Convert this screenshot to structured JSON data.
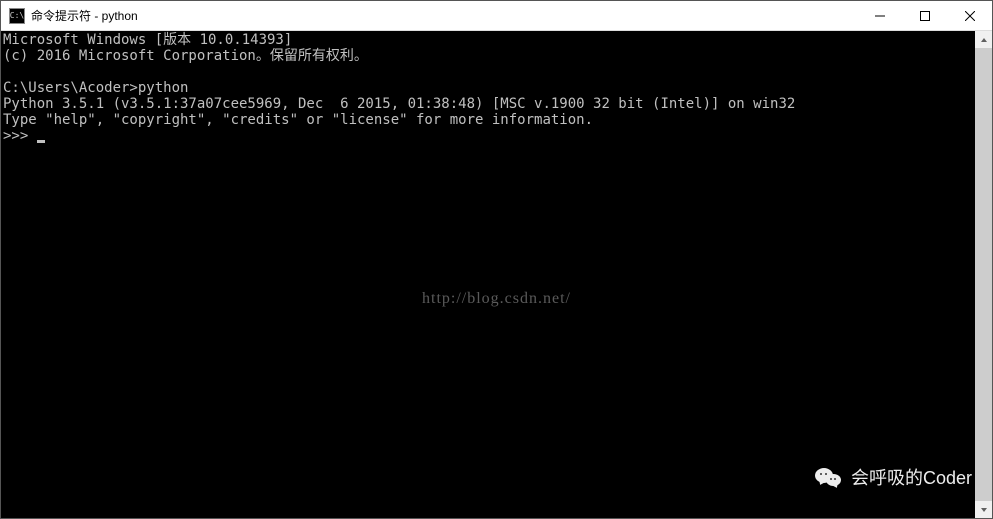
{
  "window": {
    "title": "命令提示符 - python",
    "icon_label": "C:\\"
  },
  "terminal": {
    "lines": [
      "Microsoft Windows [版本 10.0.14393]",
      "(c) 2016 Microsoft Corporation。保留所有权利。",
      "",
      "C:\\Users\\Acoder>python",
      "Python 3.5.1 (v3.5.1:37a07cee5969, Dec  6 2015, 01:38:48) [MSC v.1900 32 bit (Intel)] on win32",
      "Type \"help\", \"copyright\", \"credits\" or \"license\" for more information."
    ],
    "prompt": ">>> "
  },
  "watermark": {
    "url": "http://blog.csdn.net/",
    "bottom_text": "会呼吸的Coder"
  }
}
